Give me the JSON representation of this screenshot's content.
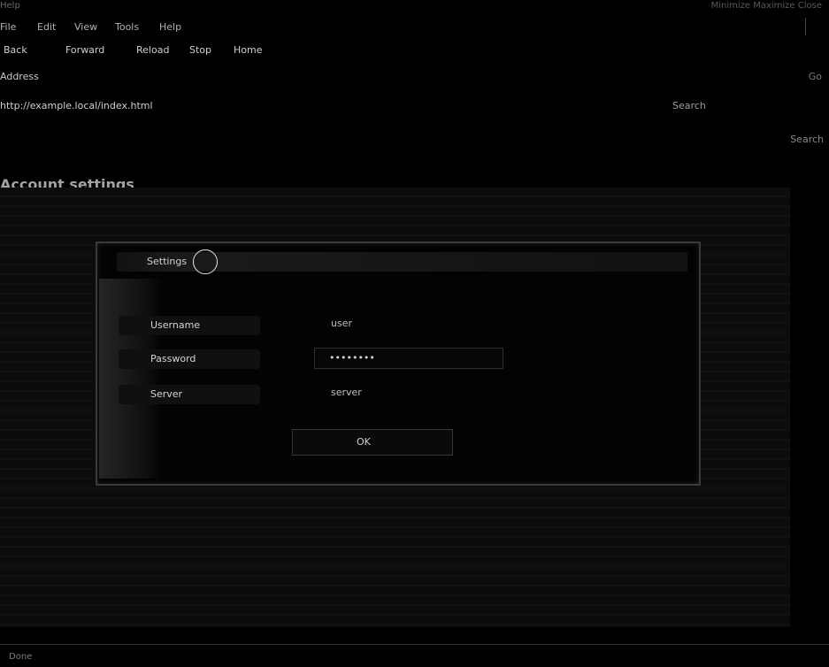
{
  "window": {
    "title": "Help",
    "right_text": "Minimize  Maximize  Close"
  },
  "menubar": {
    "items": [
      "File",
      "Edit",
      "View",
      "Tools",
      "Help"
    ]
  },
  "toolbar": {
    "buttons": [
      "Back",
      "Forward",
      "Reload",
      "Stop",
      "Home"
    ]
  },
  "addressbar": {
    "left": "Address",
    "middle": "",
    "right": "Go"
  },
  "url": {
    "value": "http://example.local/index.html",
    "go_label": "Search"
  },
  "search": {
    "hint": "Search"
  },
  "page": {
    "heading": "Account settings"
  },
  "dialog": {
    "title": "Settings",
    "close_label": "",
    "fields": [
      {
        "label": "Username",
        "value": "user"
      },
      {
        "label": "Password",
        "value": "••••••••"
      },
      {
        "label": "Server",
        "value": "server"
      }
    ],
    "ok_label": "OK"
  },
  "status": {
    "left": "Done",
    "right": ""
  }
}
